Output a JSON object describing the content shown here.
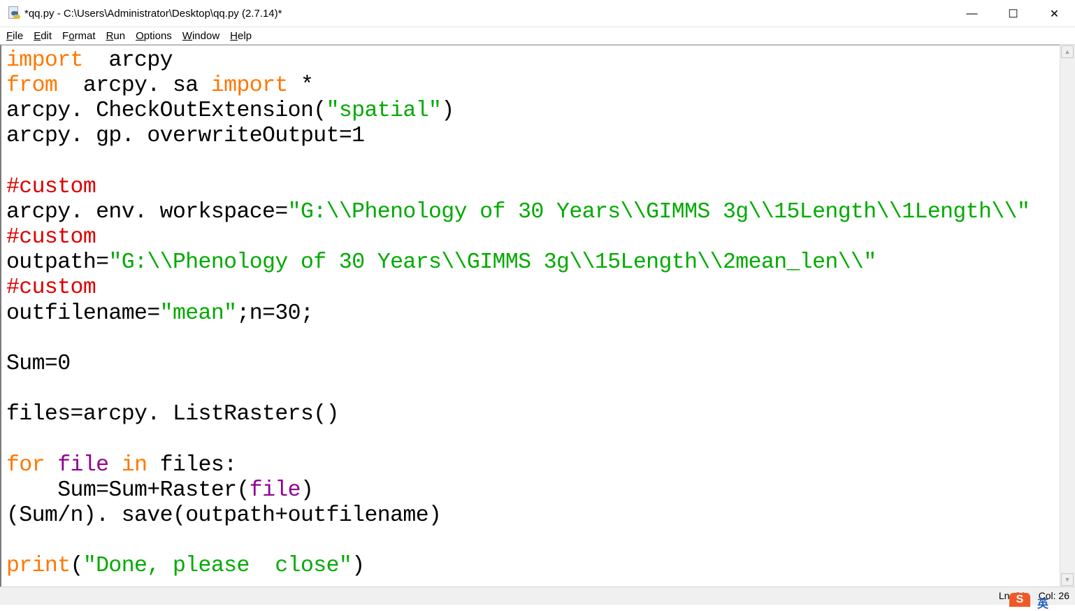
{
  "window": {
    "title": "*qq.py - C:\\Users\\Administrator\\Desktop\\qq.py (2.7.14)*",
    "controls": {
      "minimize": "—",
      "maximize": "☐",
      "close": "✕"
    }
  },
  "menu": [
    {
      "label": "File",
      "accel": "F",
      "rest": "ile"
    },
    {
      "label": "Edit",
      "accel": "E",
      "rest": "dit"
    },
    {
      "label": "Format",
      "pre": "F",
      "accel": "o",
      "rest": "rmat"
    },
    {
      "label": "Run",
      "accel": "R",
      "rest": "un"
    },
    {
      "label": "Options",
      "accel": "O",
      "rest": "ptions"
    },
    {
      "label": "Window",
      "accel": "W",
      "rest": "indow"
    },
    {
      "label": "Help",
      "accel": "H",
      "rest": "elp"
    }
  ],
  "code_lines": [
    [
      [
        "kw",
        "import"
      ],
      [
        "",
        "  arcpy"
      ]
    ],
    [
      [
        "kw",
        "from"
      ],
      [
        "",
        "  arcpy. sa "
      ],
      [
        "kw",
        "import"
      ],
      [
        "",
        " *"
      ]
    ],
    [
      [
        "",
        "arcpy. CheckOutExtension("
      ],
      [
        "str",
        "″spatial″"
      ],
      [
        "",
        ")"
      ]
    ],
    [
      [
        "",
        "arcpy. gp. overwriteOutput=1"
      ]
    ],
    [],
    [
      [
        "cmt",
        "#custom"
      ]
    ],
    [
      [
        "",
        "arcpy. env. workspace="
      ],
      [
        "str",
        "″G:\\\\Phenology of 30 Years\\\\GIMMS 3g\\\\15Length\\\\1Length\\\\″"
      ]
    ],
    [
      [
        "cmt",
        "#custom"
      ]
    ],
    [
      [
        "",
        "outpath="
      ],
      [
        "str",
        "″G:\\\\Phenology of 30 Years\\\\GIMMS 3g\\\\15Length\\\\2mean_len\\\\″"
      ]
    ],
    [
      [
        "cmt",
        "#custom"
      ]
    ],
    [
      [
        "",
        "outfilename="
      ],
      [
        "str",
        "″mean″"
      ],
      [
        "",
        ";n=30;"
      ]
    ],
    [],
    [
      [
        "",
        "Sum=0"
      ]
    ],
    [],
    [
      [
        "",
        "files=arcpy. ListRasters()"
      ]
    ],
    [],
    [
      [
        "kw",
        "for"
      ],
      [
        "",
        " "
      ],
      [
        "bi",
        "file"
      ],
      [
        "",
        " "
      ],
      [
        "kw",
        "in"
      ],
      [
        "",
        " files:"
      ]
    ],
    [
      [
        "",
        "    Sum=Sum+Raster("
      ],
      [
        "bi",
        "file"
      ],
      [
        "",
        ")"
      ]
    ],
    [
      [
        "",
        "(Sum/n). save(outpath+outfilename)"
      ]
    ],
    [],
    [
      [
        "kw",
        "print"
      ],
      [
        "",
        "("
      ],
      [
        "str",
        "″Done, please  close″"
      ],
      [
        "",
        ")"
      ]
    ]
  ],
  "status": {
    "line": "Ln: 21",
    "col": "Col: 26"
  },
  "ime": {
    "icon": "S",
    "lang": "英"
  },
  "colors": {
    "keyword": "#ff7700",
    "string": "#00aa00",
    "comment": "#dd0000",
    "builtin": "#900090"
  }
}
